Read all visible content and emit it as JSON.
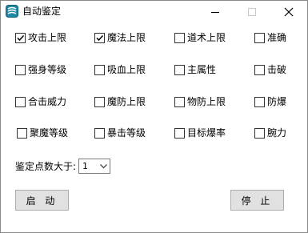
{
  "window": {
    "title": "自动鉴定"
  },
  "options": [
    {
      "label": "攻击上限",
      "checked": true
    },
    {
      "label": "魔法上限",
      "checked": true
    },
    {
      "label": "道术上限",
      "checked": false
    },
    {
      "label": "准确",
      "checked": false
    },
    {
      "label": "强身等级",
      "checked": false
    },
    {
      "label": "吸血上限",
      "checked": false
    },
    {
      "label": "主属性",
      "checked": false
    },
    {
      "label": "击破",
      "checked": false
    },
    {
      "label": "合击威力",
      "checked": false
    },
    {
      "label": "魔防上限",
      "checked": false
    },
    {
      "label": "物防上限",
      "checked": false
    },
    {
      "label": "防爆",
      "checked": false
    },
    {
      "label": "聚魔等级",
      "checked": false
    },
    {
      "label": "暴击等级",
      "checked": false
    },
    {
      "label": "目标爆率",
      "checked": false
    },
    {
      "label": "腕力",
      "checked": false
    }
  ],
  "threshold": {
    "label": "鉴定点数大于:",
    "value": "1"
  },
  "buttons": {
    "start": "启 动",
    "stop": "停 止"
  }
}
